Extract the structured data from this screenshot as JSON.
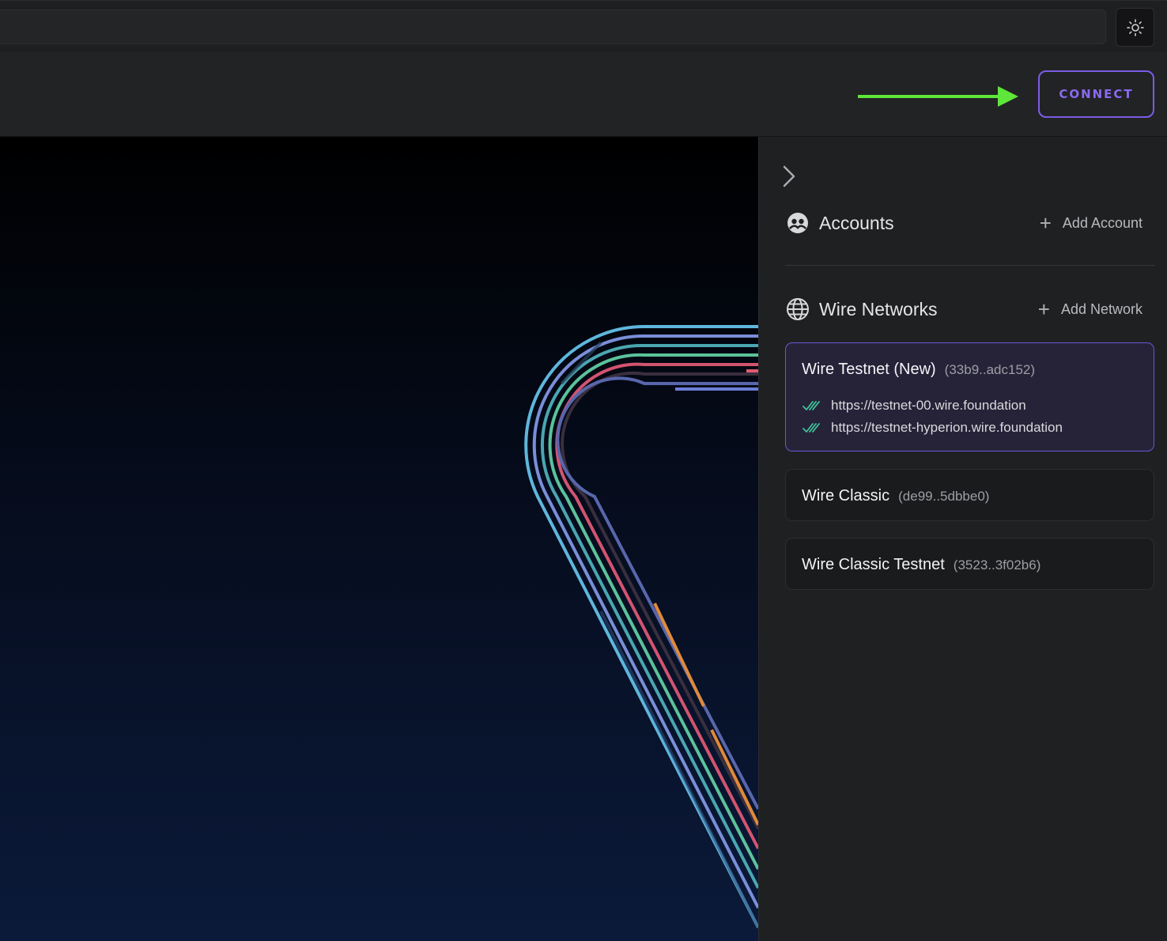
{
  "topbar": {
    "theme_toggle_icon": "sun-icon"
  },
  "header": {
    "connect_label": "CONNECT",
    "annotation_color": "#5ee63a",
    "accent": "#7c5ce6"
  },
  "sidebar": {
    "collapse_icon": "chevron-right-icon",
    "accounts": {
      "title": "Accounts",
      "add_label": "Add Account",
      "icon": "accounts-icon"
    },
    "networks": {
      "title": "Wire Networks",
      "add_label": "Add Network",
      "icon": "globe-icon",
      "items": [
        {
          "name": "Wire Testnet (New)",
          "id": "(33b9..adc152)",
          "active": true,
          "endpoints": [
            "https://testnet-00.wire.foundation",
            "https://testnet-hyperion.wire.foundation"
          ]
        },
        {
          "name": "Wire Classic",
          "id": "(de99..5dbbe0)",
          "active": false,
          "endpoints": []
        },
        {
          "name": "Wire Classic Testnet",
          "id": "(3523..3f02b6)",
          "active": false,
          "endpoints": []
        }
      ]
    }
  }
}
